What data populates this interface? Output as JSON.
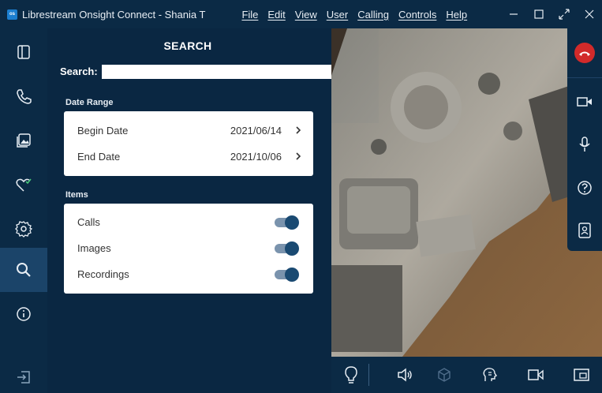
{
  "window": {
    "title": "Librestream Onsight Connect - Shania T",
    "logo_text": "os",
    "menu": [
      "File",
      "Edit",
      "View",
      "User",
      "Calling",
      "Controls",
      "Help"
    ]
  },
  "leftnav": {
    "items": [
      {
        "name": "collapse-panel",
        "icon": "sidebar-icon"
      },
      {
        "name": "calls",
        "icon": "phone-icon"
      },
      {
        "name": "gallery",
        "icon": "image-gallery-icon"
      },
      {
        "name": "favorites",
        "icon": "heart-check-icon"
      },
      {
        "name": "settings",
        "icon": "gear-icon"
      },
      {
        "name": "search",
        "icon": "search-icon",
        "active": true
      },
      {
        "name": "about",
        "icon": "info-icon"
      },
      {
        "name": "logout",
        "icon": "logout-icon"
      }
    ]
  },
  "search": {
    "title": "SEARCH",
    "label": "Search:",
    "value": "",
    "date_range": {
      "label": "Date Range",
      "begin_label": "Begin Date",
      "begin_value": "2021/06/14",
      "end_label": "End Date",
      "end_value": "2021/10/06"
    },
    "items": {
      "label": "Items",
      "rows": [
        {
          "label": "Calls",
          "on": true
        },
        {
          "label": "Images",
          "on": true
        },
        {
          "label": "Recordings",
          "on": true
        }
      ]
    }
  },
  "colors": {
    "background": "#0b2a45",
    "panel": "#0a2742",
    "active_nav": "#1b4469",
    "toggle_knob": "#1a4a72",
    "end_call": "#d22a2a"
  },
  "video_controls": {
    "right": [
      "end-call-icon",
      "video-camera-icon",
      "microphone-icon",
      "help-icon",
      "contacts-icon"
    ],
    "bottom": [
      "lightbulb-icon",
      "speaker-icon",
      "cube-icon",
      "telestrate-icon",
      "video-camera-icon",
      "picture-in-picture-icon"
    ]
  }
}
